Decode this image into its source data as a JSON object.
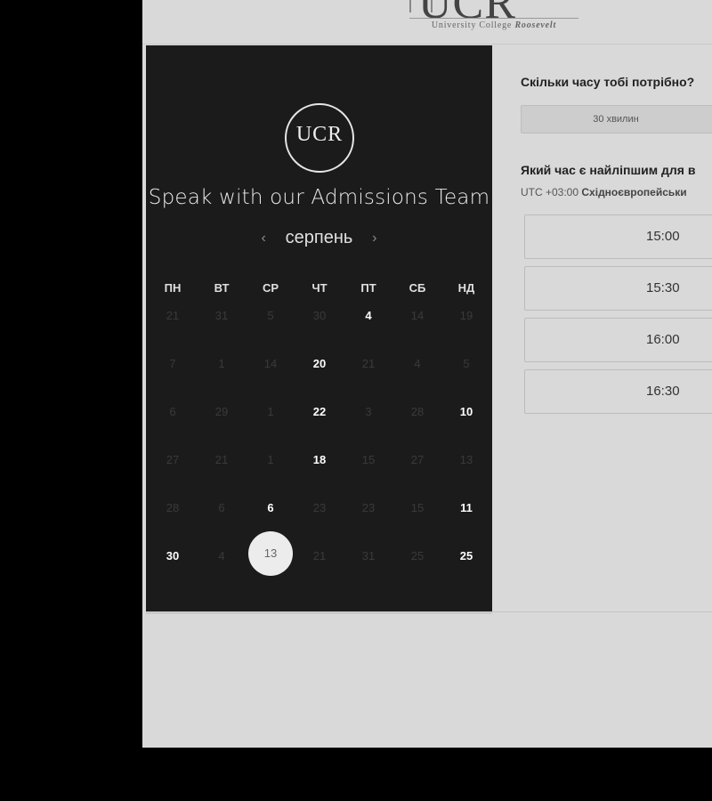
{
  "logo": {
    "mark": "UCR",
    "subtitle_prefix": "University College ",
    "subtitle_name": "Roosevelt"
  },
  "panel": {
    "badge_text": "UCR",
    "title": "Speak with our Admissions Team",
    "month": "серпень",
    "prev_icon": "‹",
    "next_icon": "›",
    "weekdays": [
      "ПН",
      "ВТ",
      "СР",
      "ЧТ",
      "ПТ",
      "СБ",
      "НД"
    ],
    "weeks": [
      [
        "21",
        "31",
        "5",
        "30",
        "4",
        "14",
        "19"
      ],
      [
        "7",
        "1",
        "14",
        "20",
        "21",
        "4",
        "5"
      ],
      [
        "6",
        "29",
        "1",
        "22",
        "3",
        "28",
        "10"
      ],
      [
        "27",
        "21",
        "1",
        "18",
        "15",
        "27",
        "13"
      ],
      [
        "28",
        "6",
        "6",
        "23",
        "23",
        "15",
        "11"
      ],
      [
        "30",
        "4",
        "13",
        "21",
        "31",
        "25",
        "25"
      ]
    ],
    "available": [
      [
        0,
        4
      ],
      [
        1,
        3
      ],
      [
        2,
        3
      ],
      [
        2,
        6
      ],
      [
        3,
        3
      ],
      [
        4,
        2
      ],
      [
        4,
        6
      ],
      [
        5,
        0
      ],
      [
        5,
        6
      ]
    ],
    "selected": [
      5,
      2
    ]
  },
  "booking": {
    "question_duration": "Скільки часу тобі потрібно?",
    "duration_value": "30 хвилин",
    "question_time": "Який час є найліпшим для в",
    "timezone_offset": "UTC +03:00",
    "timezone_name": "Східноєвропейськи",
    "slots": [
      "15:00",
      "15:30",
      "16:00",
      "16:30"
    ]
  }
}
